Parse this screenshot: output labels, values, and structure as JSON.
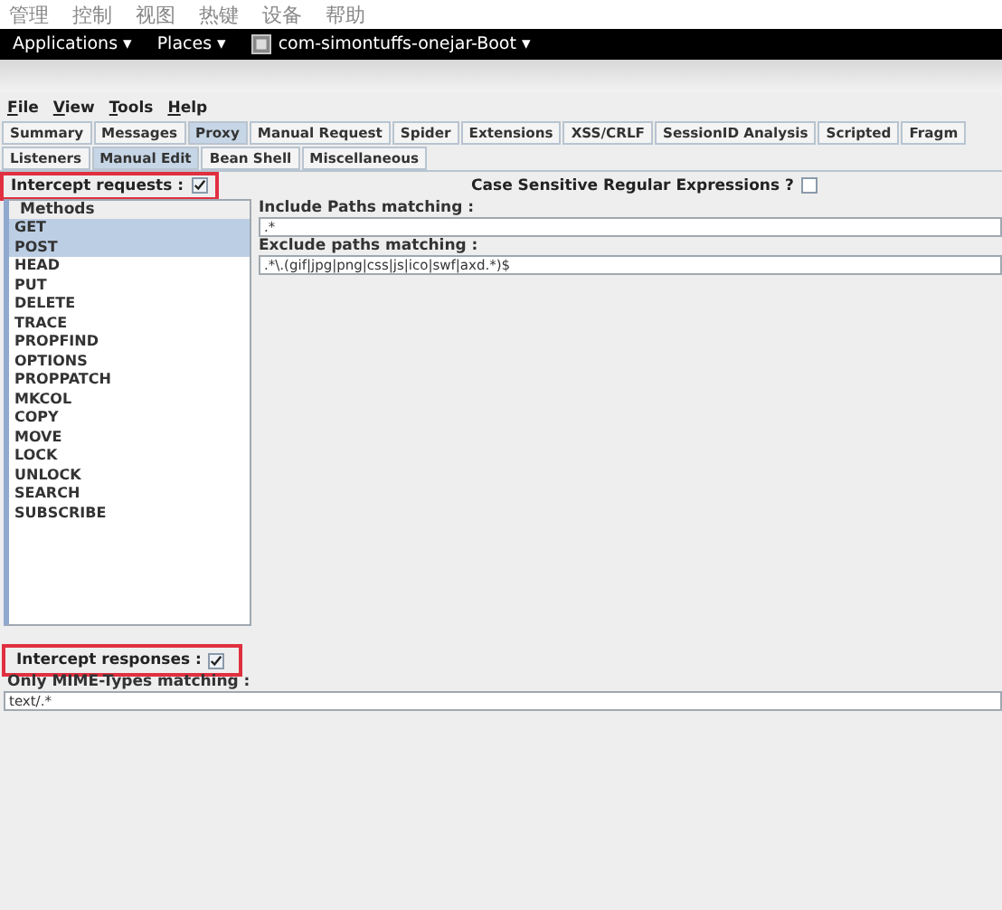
{
  "host_menu": [
    "管理",
    "控制",
    "视图",
    "热键",
    "设备",
    "帮助"
  ],
  "top_bar": {
    "menus": [
      {
        "label": "Applications",
        "caret": "▾"
      },
      {
        "label": "Places",
        "caret": "▾"
      }
    ],
    "window_title": "com-simontuffs-onejar-Boot",
    "window_caret": "▾"
  },
  "menu_bar": [
    "File",
    "View",
    "Tools",
    "Help"
  ],
  "tabs": [
    {
      "label": "Summary",
      "selected": false
    },
    {
      "label": "Messages",
      "selected": false
    },
    {
      "label": "Proxy",
      "selected": true
    },
    {
      "label": "Manual Request",
      "selected": false
    },
    {
      "label": "Spider",
      "selected": false
    },
    {
      "label": "Extensions",
      "selected": false
    },
    {
      "label": "XSS/CRLF",
      "selected": false
    },
    {
      "label": "SessionID Analysis",
      "selected": false
    },
    {
      "label": "Scripted",
      "selected": false
    },
    {
      "label": "Fragm",
      "selected": false
    }
  ],
  "subtabs": [
    {
      "label": "Listeners",
      "selected": false
    },
    {
      "label": "Manual Edit",
      "selected": true
    },
    {
      "label": "Bean Shell",
      "selected": false
    },
    {
      "label": "Miscellaneous",
      "selected": false
    }
  ],
  "intercept_requests": {
    "label": "Intercept requests :",
    "checked": true,
    "highlighted": true
  },
  "case_sensitive": {
    "label": "Case Sensitive Regular Expressions ?",
    "checked": false
  },
  "methods": {
    "title": "Methods",
    "items": [
      {
        "label": "GET",
        "selected": true
      },
      {
        "label": "POST",
        "selected": true
      },
      {
        "label": "HEAD",
        "selected": false
      },
      {
        "label": "PUT",
        "selected": false
      },
      {
        "label": "DELETE",
        "selected": false
      },
      {
        "label": "TRACE",
        "selected": false
      },
      {
        "label": "PROPFIND",
        "selected": false
      },
      {
        "label": "OPTIONS",
        "selected": false
      },
      {
        "label": "PROPPATCH",
        "selected": false
      },
      {
        "label": "MKCOL",
        "selected": false
      },
      {
        "label": "COPY",
        "selected": false
      },
      {
        "label": "MOVE",
        "selected": false
      },
      {
        "label": "LOCK",
        "selected": false
      },
      {
        "label": "UNLOCK",
        "selected": false
      },
      {
        "label": "SEARCH",
        "selected": false
      },
      {
        "label": "SUBSCRIBE",
        "selected": false
      }
    ]
  },
  "include_paths": {
    "label": "Include Paths matching :",
    "value": ".*"
  },
  "exclude_paths": {
    "label": "Exclude paths matching :",
    "value": ".*\\.(gif|jpg|png|css|js|ico|swf|axd.*)$"
  },
  "intercept_responses": {
    "label": "Intercept responses :",
    "checked": true,
    "highlighted": true
  },
  "mime_types": {
    "label": "Only MIME-Types matching :",
    "value": "text/.*"
  }
}
